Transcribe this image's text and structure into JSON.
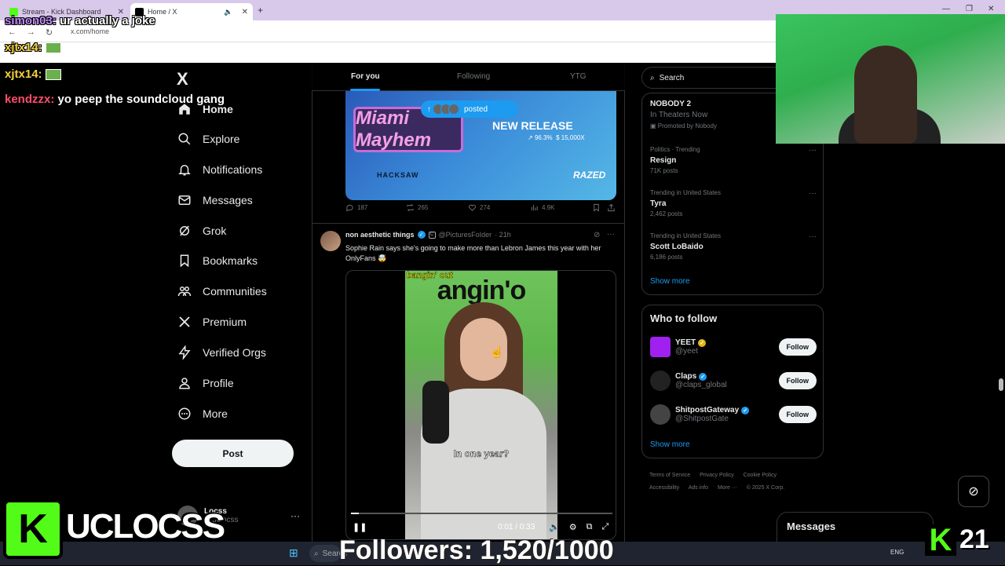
{
  "browser": {
    "tabs": [
      {
        "label": "Stream - Kick Dashboard"
      },
      {
        "label": "Home / X"
      }
    ],
    "url": "x.com/home"
  },
  "colors": {
    "accent": "#1d9bf0",
    "kick_green": "#53fc18",
    "background": "#000000"
  },
  "sidebar": {
    "logo": "X",
    "items": [
      {
        "label": "Home",
        "icon": "home-icon"
      },
      {
        "label": "Explore",
        "icon": "search-icon"
      },
      {
        "label": "Notifications",
        "icon": "bell-icon"
      },
      {
        "label": "Messages",
        "icon": "mail-icon"
      },
      {
        "label": "Grok",
        "icon": "grok-icon"
      },
      {
        "label": "Bookmarks",
        "icon": "bookmark-icon"
      },
      {
        "label": "Communities",
        "icon": "people-icon"
      },
      {
        "label": "Premium",
        "icon": "x-icon"
      },
      {
        "label": "Verified Orgs",
        "icon": "lightning-icon"
      },
      {
        "label": "Profile",
        "icon": "person-icon"
      },
      {
        "label": "More",
        "icon": "more-circle-icon"
      }
    ],
    "post_button": "Post",
    "account": {
      "name": "Locss",
      "handle": "@uclocss"
    }
  },
  "feed": {
    "tabs": [
      "For you",
      "Following",
      "YTG"
    ],
    "posted_pill": "posted",
    "promo": {
      "brand": "Miami Mayhem",
      "headline": "NEW RELEASE",
      "rtp": "96.3%",
      "max_win": "15,000X",
      "studio": "HACKSAW",
      "partner": "RAZED"
    },
    "promo_actions": {
      "replies": "187",
      "reposts": "265",
      "likes": "274",
      "views": "4.9K"
    },
    "tweet": {
      "name": "non aesthetic things",
      "handle": "@PicturesFoIder",
      "time": "· 21h",
      "text": "Sophie Rain says she's going to make more than Lebron James this year with her OnlyFans 🤯",
      "video": {
        "top_text": "bangin' out",
        "banner": "angin'o",
        "caption": "In one year?",
        "time": "0:01 / 0:33",
        "progress": 0.03
      }
    }
  },
  "right": {
    "search_placeholder": "Search",
    "promoted_trend": {
      "title": "NOBODY 2",
      "subtitle": "In Theaters Now",
      "promoter": "Promoted by Nobody"
    },
    "trends": [
      {
        "context": "Politics · Trending",
        "title": "Resign",
        "posts": "71K posts"
      },
      {
        "context": "Trending in United States",
        "title": "Tyra",
        "posts": "2,462 posts"
      },
      {
        "context": "Trending in United States",
        "title": "Scott LoBaido",
        "posts": "6,186 posts"
      }
    ],
    "show_more": "Show more",
    "who_to_follow": {
      "title": "Who to follow",
      "accounts": [
        {
          "name": "YEET",
          "handle": "@yeet",
          "color": "#a020f0",
          "check": "gold"
        },
        {
          "name": "Claps",
          "handle": "@claps_global",
          "color": "#222222",
          "check": "blue"
        },
        {
          "name": "ShitpostGateway",
          "handle": "@ShitpostGate",
          "color": "#444444",
          "check": "blue"
        }
      ],
      "follow_label": "Follow",
      "show_more": "Show more"
    },
    "footer": [
      "Terms of Service",
      "Privacy Policy",
      "Cookie Policy",
      "Accessibility",
      "Ads info",
      "More ···",
      "© 2025 X Corp."
    ],
    "messages_drawer": "Messages"
  },
  "stream": {
    "chat": [
      {
        "user": "simon03:",
        "message": "ur actually a joke"
      },
      {
        "user": "xjtx14:",
        "message": ""
      },
      {
        "user": "xjtx14:",
        "message": ""
      },
      {
        "user": "kendzzx:",
        "message": "yo peep the soundcloud gang"
      }
    ],
    "channel_logo": "K",
    "channel_name": "UCLOCSS",
    "followers_text": "Followers: 1,520/1000",
    "viewer_count": "21"
  },
  "taskbar": {
    "search": "Search",
    "lang": "ENG"
  }
}
